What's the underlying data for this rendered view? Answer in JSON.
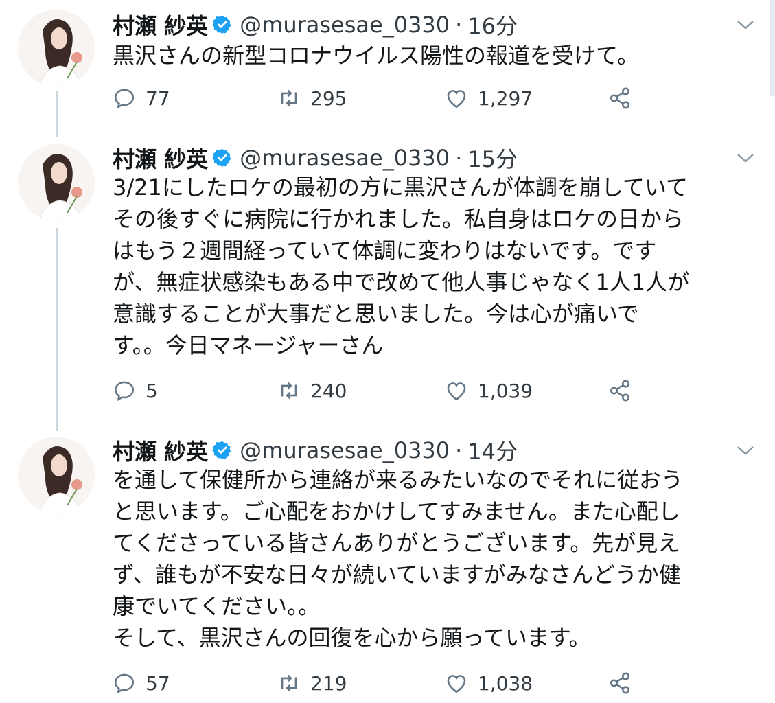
{
  "colors": {
    "verified": "#1da1f2",
    "icon": "#657786",
    "thread_line": "#ccd6dd"
  },
  "tweets": [
    {
      "display_name": "村瀬 紗英",
      "handle": "@murasesae_0330",
      "separator": "·",
      "time": "16分",
      "text": "黒沢さんの新型コロナウイルス陽性の報道を受けて。",
      "replies": "77",
      "retweets": "295",
      "likes": "1,297"
    },
    {
      "display_name": "村瀬 紗英",
      "handle": "@murasesae_0330",
      "separator": "·",
      "time": "15分",
      "text": "3/21にしたロケの最初の方に黒沢さんが体調を崩していて\nその後すぐに病院に行かれました。私自身はロケの日から\nはもう２週間経っていて体調に変わりはないです。です\nが、無症状感染もある中で改めて他人事じゃなく1人1人が\n意識することが大事だと思いました。今は心が痛いで\nす。。今日マネージャーさん",
      "replies": "5",
      "retweets": "240",
      "likes": "1,039"
    },
    {
      "display_name": "村瀬 紗英",
      "handle": "@murasesae_0330",
      "separator": "·",
      "time": "14分",
      "text": "を通して保健所から連絡が来るみたいなのでそれに従おう\nと思います。ご心配をおかけしてすみません。また心配し\nてくださっている皆さんありがとうございます。先が見え\nず、誰もが不安な日々が続いていますがみなさんどうか健\n康でいてください。。\nそして、黒沢さんの回復を心から願っています。",
      "replies": "57",
      "retweets": "219",
      "likes": "1,038"
    }
  ]
}
